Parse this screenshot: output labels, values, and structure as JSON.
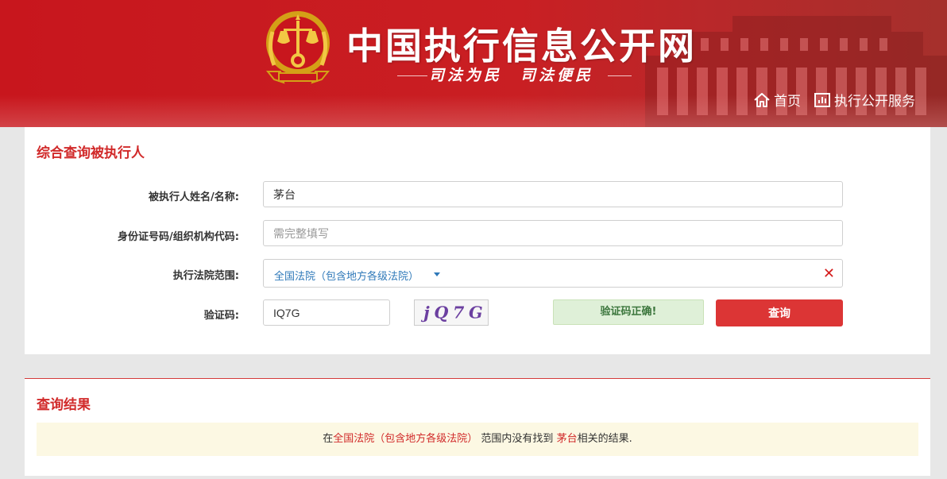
{
  "header": {
    "site_title": "中国执行信息公开网",
    "slogan": "司法为民　司法便民",
    "nav": [
      {
        "label": "首页",
        "icon": "home-icon"
      },
      {
        "label": "执行公开服务",
        "icon": "bar-chart-icon"
      }
    ]
  },
  "form": {
    "title": "综合查询被执行人",
    "name_label": "被执行人姓名/名称:",
    "name_value": "茅台",
    "id_label": "身份证号码/组织机构代码:",
    "id_placeholder": "需完整填写",
    "court_label": "执行法院范围:",
    "court_value": "全国法院（包含地方各级法院）",
    "captcha_label": "验证码:",
    "captcha_value": "IQ7G",
    "captcha_image_text": "jQ7G",
    "captcha_status": "验证码正确!",
    "query_button": "查询"
  },
  "result": {
    "title": "查询结果",
    "prefix": "在",
    "scope": "全国法院（包含地方各级法院）",
    "middle": "范围内没有找到",
    "keyword": "茅台",
    "suffix": "相关的结果."
  },
  "colors": {
    "brand_red": "#c8161d",
    "accent_red": "#dc3535",
    "link_blue": "#2f79b9",
    "success_bg": "#dff0d8",
    "notice_bg": "#fcf8e3"
  }
}
